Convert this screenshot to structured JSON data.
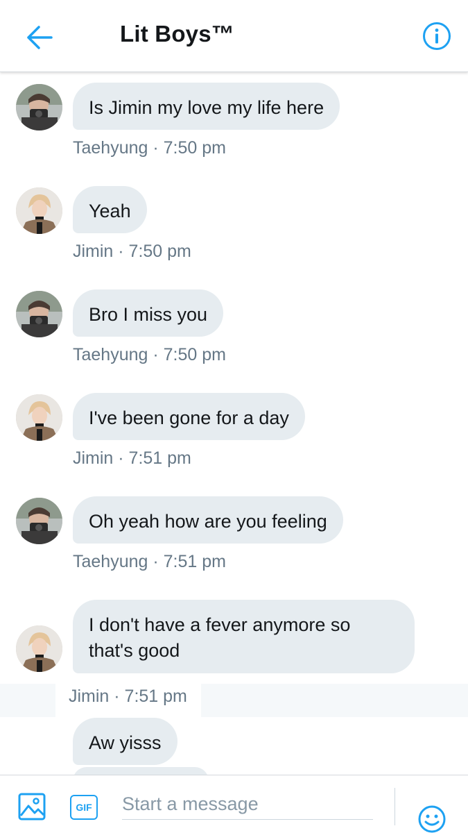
{
  "header": {
    "title": "Lit Boys™",
    "back_icon": "arrow-left-icon",
    "info_icon": "info-circle-icon",
    "accent": "#1da1f2"
  },
  "messages": [
    {
      "sender": "Taehyung",
      "text": "Is Jimin my love my life here",
      "meta": "Taehyung · 7:50 pm"
    },
    {
      "sender": "Jimin",
      "text": "Yeah",
      "meta": "Jimin · 7:50 pm"
    },
    {
      "sender": "Taehyung",
      "text": "Bro I miss you",
      "meta": "Taehyung · 7:50 pm"
    },
    {
      "sender": "Jimin",
      "text": "I've been gone for a day",
      "meta": "Jimin · 7:51 pm"
    },
    {
      "sender": "Taehyung",
      "text": "Oh yeah how are you feeling",
      "meta": "Taehyung · 7:51 pm"
    },
    {
      "sender": "Jimin",
      "text": "I don't have a fever anymore so that's good",
      "meta": "Jimin · 7:51 pm"
    },
    {
      "sender": "Jimin",
      "text": "Aw yisss",
      "meta": ""
    }
  ],
  "composer": {
    "placeholder": "Start a message",
    "gif_label": "GIF",
    "media_icon": "image-icon",
    "emoji_icon": "smiley-icon"
  },
  "colors": {
    "bubble": "#e6ecf0",
    "meta_text": "#657786",
    "text": "#14171a"
  }
}
